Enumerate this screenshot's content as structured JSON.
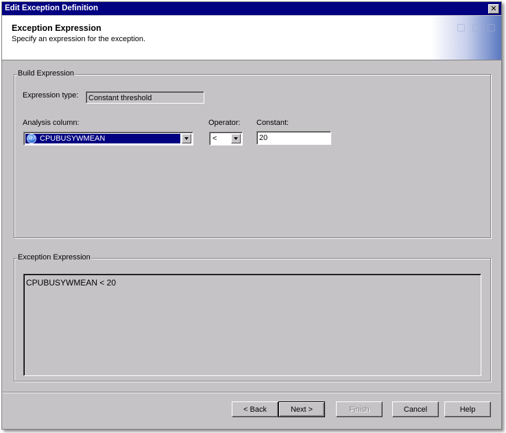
{
  "window": {
    "title": "Edit Exception Definition",
    "close_icon": "close-icon"
  },
  "banner": {
    "title": "Exception Expression",
    "subtitle": "Specify an expression for the exception."
  },
  "build_expression": {
    "group_label": "Build Expression",
    "expression_type_label": "Expression type:",
    "expression_type_value": "Constant threshold",
    "analysis_column_label": "Analysis column:",
    "analysis_column_value": "CPUBUSYWMEAN",
    "analysis_column_icon": "numeric-column-icon",
    "operator_label": "Operator:",
    "operator_value": "<",
    "constant_label": "Constant:",
    "constant_value": "20"
  },
  "exception_expression": {
    "group_label": "Exception Expression",
    "value": "CPUBUSYWMEAN < 20"
  },
  "buttons": {
    "back": "< Back",
    "next": "Next >",
    "finish": "Finish",
    "cancel": "Cancel",
    "help": "Help"
  }
}
